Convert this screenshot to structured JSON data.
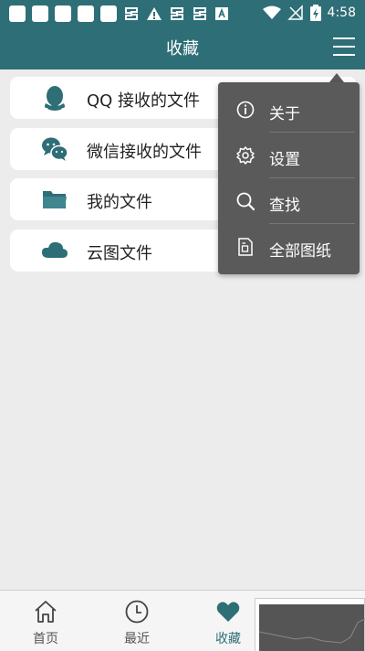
{
  "status_bar": {
    "time": "4:58",
    "left_icons": [
      "notification-square",
      "notification-square",
      "notification-square",
      "notification-square",
      "notification-square",
      "app-notification",
      "warning",
      "app-notification",
      "app-notification",
      "a-badge"
    ],
    "right_icons": [
      "wifi",
      "no-signal",
      "battery-charging"
    ]
  },
  "header": {
    "title": "收藏",
    "menu_icon": "hamburger-menu-icon"
  },
  "list": {
    "items": [
      {
        "label": "QQ 接收的文件",
        "icon": "qq-icon"
      },
      {
        "label": "微信接收的文件",
        "icon": "wechat-icon"
      },
      {
        "label": "我的文件",
        "icon": "folder-icon"
      },
      {
        "label": "云图文件",
        "icon": "cloud-icon"
      }
    ]
  },
  "popup_menu": {
    "items": [
      {
        "label": "关于",
        "icon": "info-icon"
      },
      {
        "label": "设置",
        "icon": "gear-icon"
      },
      {
        "label": "查找",
        "icon": "search-icon"
      },
      {
        "label": "全部图纸",
        "icon": "drawing-file-icon"
      }
    ]
  },
  "bottom_nav": {
    "items": [
      {
        "label": "首页",
        "icon": "home-icon"
      },
      {
        "label": "最近",
        "icon": "clock-icon"
      },
      {
        "label": "收藏",
        "icon": "heart-icon",
        "active": true
      }
    ]
  },
  "colors": {
    "primary": "#2e6e76",
    "popup_bg": "#5a5a5a",
    "background": "#ececec"
  }
}
